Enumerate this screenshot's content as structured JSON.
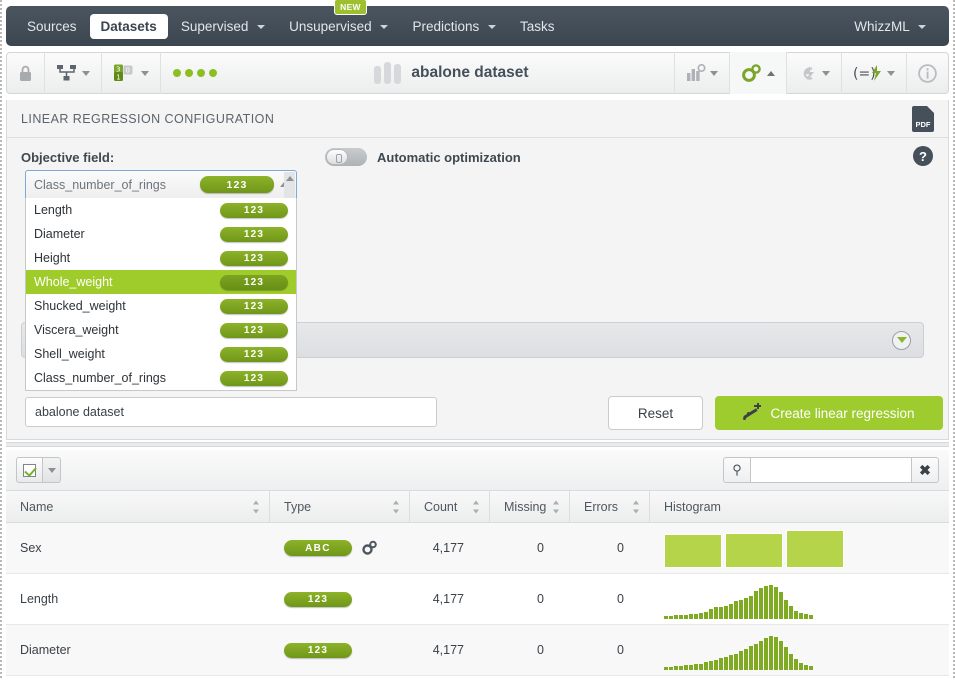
{
  "topnav": {
    "items": [
      {
        "label": "Sources",
        "active": false,
        "caret": false,
        "badge": null
      },
      {
        "label": "Datasets",
        "active": true,
        "caret": false,
        "badge": null
      },
      {
        "label": "Supervised",
        "active": false,
        "caret": true,
        "badge": null
      },
      {
        "label": "Unsupervised",
        "active": false,
        "caret": true,
        "badge": "NEW"
      },
      {
        "label": "Predictions",
        "active": false,
        "caret": true,
        "badge": null
      },
      {
        "label": "Tasks",
        "active": false,
        "caret": false,
        "badge": null
      }
    ],
    "right_label": "WhizzML"
  },
  "resource_toolbar": {
    "lock_icon": "lock-icon",
    "share_icon": "network-share-icon",
    "fields_icon": "field-types-icon",
    "status_dots": 4,
    "dataset_title": "abalone dataset",
    "right_icons": [
      {
        "name": "chart-config-icon",
        "glyph": "chart"
      },
      {
        "name": "model-gear-icon",
        "glyph": "gears",
        "active": true
      },
      {
        "name": "flash-cloud-icon",
        "glyph": "flash"
      },
      {
        "name": "script-flash-icon",
        "glyph": "(=)"
      },
      {
        "name": "info-icon",
        "glyph": "i"
      }
    ]
  },
  "config": {
    "title": "LINEAR REGRESSION CONFIGURATION",
    "pdf_label": "PDF",
    "help_label": "?",
    "objective_label": "Objective field:",
    "auto_opt_label": "Automatic optimization",
    "auto_opt_on": false,
    "dropdown": {
      "selected": "Class_number_of_rings",
      "selected_badge": "123",
      "options": [
        {
          "label": "Length",
          "badge": "123",
          "highlighted": false
        },
        {
          "label": "Diameter",
          "badge": "123",
          "highlighted": false
        },
        {
          "label": "Height",
          "badge": "123",
          "highlighted": false
        },
        {
          "label": "Whole_weight",
          "badge": "123",
          "highlighted": true
        },
        {
          "label": "Shucked_weight",
          "badge": "123",
          "highlighted": false
        },
        {
          "label": "Viscera_weight",
          "badge": "123",
          "highlighted": false
        },
        {
          "label": "Shell_weight",
          "badge": "123",
          "highlighted": false
        },
        {
          "label": "Class_number_of_rings",
          "badge": "123",
          "highlighted": false
        }
      ]
    },
    "name_value": "abalone dataset",
    "name_placeholder": "abalone dataset",
    "reset_label": "Reset",
    "create_label": "Create linear regression"
  },
  "fields_table": {
    "search_value": "",
    "search_placeholder": "",
    "columns": [
      "Name",
      "Type",
      "Count",
      "Missing",
      "Errors",
      "Histogram"
    ],
    "rows": [
      {
        "name": "Sex",
        "type": "ABC",
        "type_kind": "categorical",
        "has_gear": true,
        "count": "4,177",
        "missing": "0",
        "errors": "0",
        "histogram": {
          "kind": "categorical",
          "values": [
            30,
            31,
            34
          ]
        }
      },
      {
        "name": "Length",
        "type": "123",
        "type_kind": "numeric",
        "has_gear": false,
        "count": "4,177",
        "missing": "0",
        "errors": "0",
        "histogram": {
          "kind": "numeric",
          "values": [
            3,
            3,
            4,
            4,
            4,
            5,
            5,
            6,
            7,
            9,
            11,
            11,
            12,
            14,
            17,
            18,
            20,
            22,
            26,
            29,
            31,
            32,
            30,
            25,
            18,
            12,
            8,
            6,
            5,
            4
          ]
        }
      },
      {
        "name": "Diameter",
        "type": "123",
        "type_kind": "numeric",
        "has_gear": false,
        "count": "4,177",
        "missing": "0",
        "errors": "0",
        "histogram": {
          "kind": "numeric",
          "values": [
            3,
            3,
            4,
            4,
            5,
            5,
            6,
            6,
            8,
            9,
            10,
            12,
            13,
            15,
            16,
            18,
            20,
            23,
            25,
            28,
            31,
            33,
            32,
            28,
            22,
            16,
            11,
            7,
            5,
            4
          ]
        }
      }
    ]
  },
  "colors": {
    "brand_green": "#9ecb2d",
    "badge_green": "#7da321",
    "nav_dark": "#3c4650",
    "highlight_green": "#9fcc2b"
  }
}
